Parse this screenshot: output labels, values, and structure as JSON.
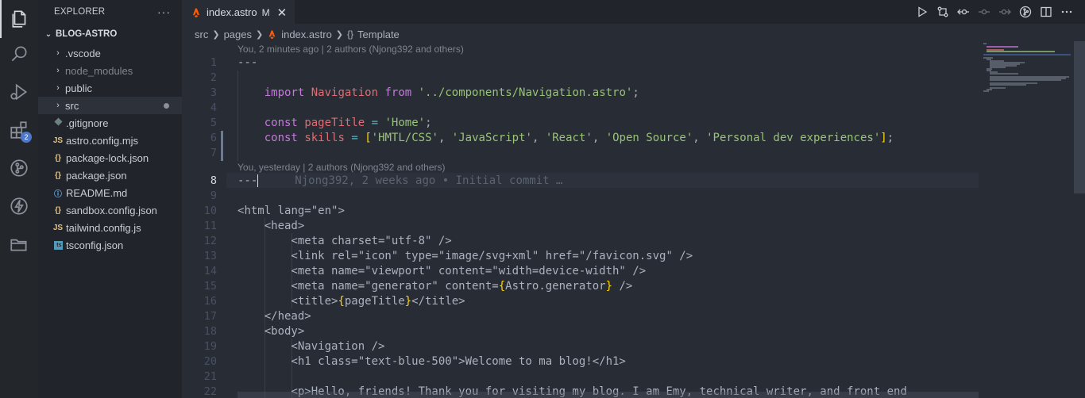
{
  "activity_bar": {
    "items": [
      {
        "name": "explorer-icon",
        "active": true
      },
      {
        "name": "search-icon"
      },
      {
        "name": "run-debug-icon"
      },
      {
        "name": "extensions-icon",
        "badge": "2"
      },
      {
        "name": "source-control-icon"
      },
      {
        "name": "lightning-icon"
      },
      {
        "name": "folders-icon"
      }
    ]
  },
  "sidebar": {
    "title": "EXPLORER",
    "more": "···",
    "section": "BLOG-ASTRO",
    "items": [
      {
        "label": ".vscode",
        "type": "folder"
      },
      {
        "label": "node_modules",
        "type": "folder",
        "dim": true
      },
      {
        "label": "public",
        "type": "folder"
      },
      {
        "label": "src",
        "type": "folder",
        "selected": true,
        "modified": true
      },
      {
        "label": ".gitignore",
        "type": "file",
        "icon": "git-icon",
        "icon_color": "#6d8086"
      },
      {
        "label": "astro.config.mjs",
        "type": "file",
        "icon": "js-icon",
        "icon_glyph": "JS",
        "icon_color": "#e5c07b"
      },
      {
        "label": "package-lock.json",
        "type": "file",
        "icon": "json-icon",
        "icon_glyph": "{}",
        "icon_color": "#e5c07b"
      },
      {
        "label": "package.json",
        "type": "file",
        "icon": "json-icon",
        "icon_glyph": "{}",
        "icon_color": "#e5c07b"
      },
      {
        "label": "README.md",
        "type": "file",
        "icon": "info-icon",
        "icon_glyph": "ⓘ",
        "icon_color": "#61afef"
      },
      {
        "label": "sandbox.config.json",
        "type": "file",
        "icon": "json-icon",
        "icon_glyph": "{}",
        "icon_color": "#e5c07b"
      },
      {
        "label": "tailwind.config.js",
        "type": "file",
        "icon": "js-icon",
        "icon_glyph": "JS",
        "icon_color": "#e5c07b"
      },
      {
        "label": "tsconfig.json",
        "type": "file",
        "icon": "ts-icon",
        "icon_glyph": "ts",
        "icon_color": "#519aba"
      }
    ]
  },
  "tab": {
    "label": "index.astro",
    "status": "M",
    "close": "✕"
  },
  "breadcrumb": {
    "parts": [
      "src",
      "pages",
      "index.astro",
      "Template"
    ],
    "symbol_glyph": "{}"
  },
  "codelens": {
    "top": "You, 2 minutes ago | 2 authors (Njong392 and others)",
    "middle": "You, yesterday | 2 authors (Njong392 and others)"
  },
  "blame": "Njong392, 2 weeks ago • Initial commit …",
  "current_line": 8,
  "colors": {
    "astro_orange": "#ff5a03",
    "keyword": "#c678dd",
    "string": "#98c379",
    "variable": "#e06c75",
    "class": "#e5c07b"
  }
}
